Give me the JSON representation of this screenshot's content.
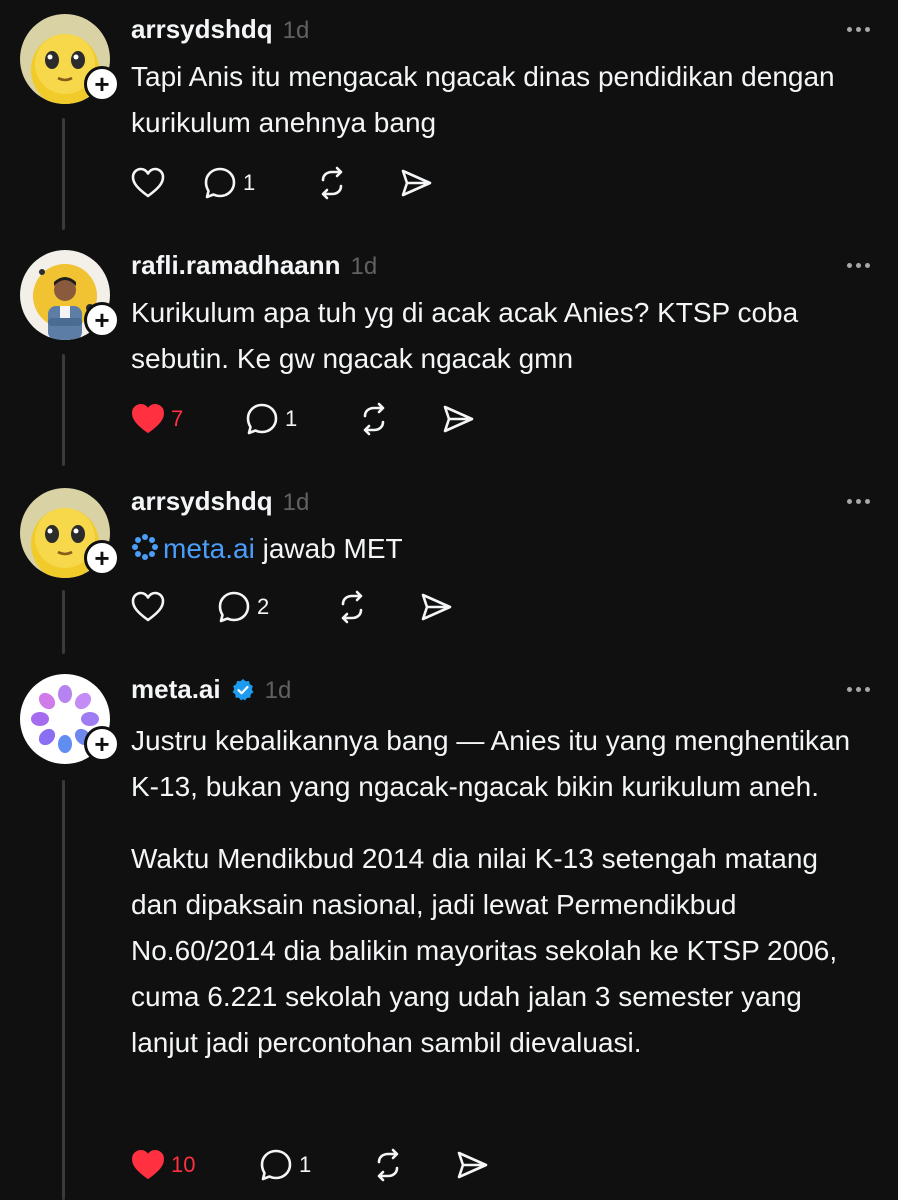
{
  "posts": [
    {
      "username": "arrsydshdq",
      "time": "1d",
      "text": "Tapi Anis itu mengacak ngacak dinas pendidikan dengan kurikulum anehnya bang",
      "likes": "",
      "liked": false,
      "replies": "1",
      "avatar_icon": "yellow-creature-avatar"
    },
    {
      "username": "rafli.ramadhaann",
      "time": "1d",
      "text": "Kurikulum apa tuh yg di acak acak Anies? KTSP coba sebutin. Ke gw ngacak ngacak gmn",
      "likes": "7",
      "liked": true,
      "replies": "1",
      "avatar_icon": "person-photo-avatar"
    },
    {
      "username": "arrsydshdq",
      "time": "1d",
      "mention": "meta.ai",
      "text": "jawab MET",
      "likes": "",
      "liked": false,
      "replies": "2",
      "avatar_icon": "yellow-creature-avatar"
    },
    {
      "username": "meta.ai",
      "time": "1d",
      "verified": true,
      "paragraphs": [
        "Justru kebalikannya bang — Anies itu yang menghentikan K-13, bukan yang ngacak-ngacak bikin kurikulum aneh.",
        "Waktu Mendikbud 2014 dia nilai K-13 setengah matang dan dipaksain nasional, jadi lewat Permendikbud No.60/2014 dia balikin mayoritas sekolah ke KTSP 2006, cuma 6.221 sekolah yang udah jalan 3 semester yang lanjut jadi percontohan sambil dievaluasi."
      ],
      "likes": "10",
      "liked": true,
      "replies": "1",
      "avatar_icon": "meta-ai-avatar"
    }
  ],
  "colors": {
    "background": "#101010",
    "text": "#f3f5f7",
    "muted": "#616161",
    "like_active": "#ff3040",
    "mention": "#4a9df8",
    "verified": "#1d9bf0"
  }
}
